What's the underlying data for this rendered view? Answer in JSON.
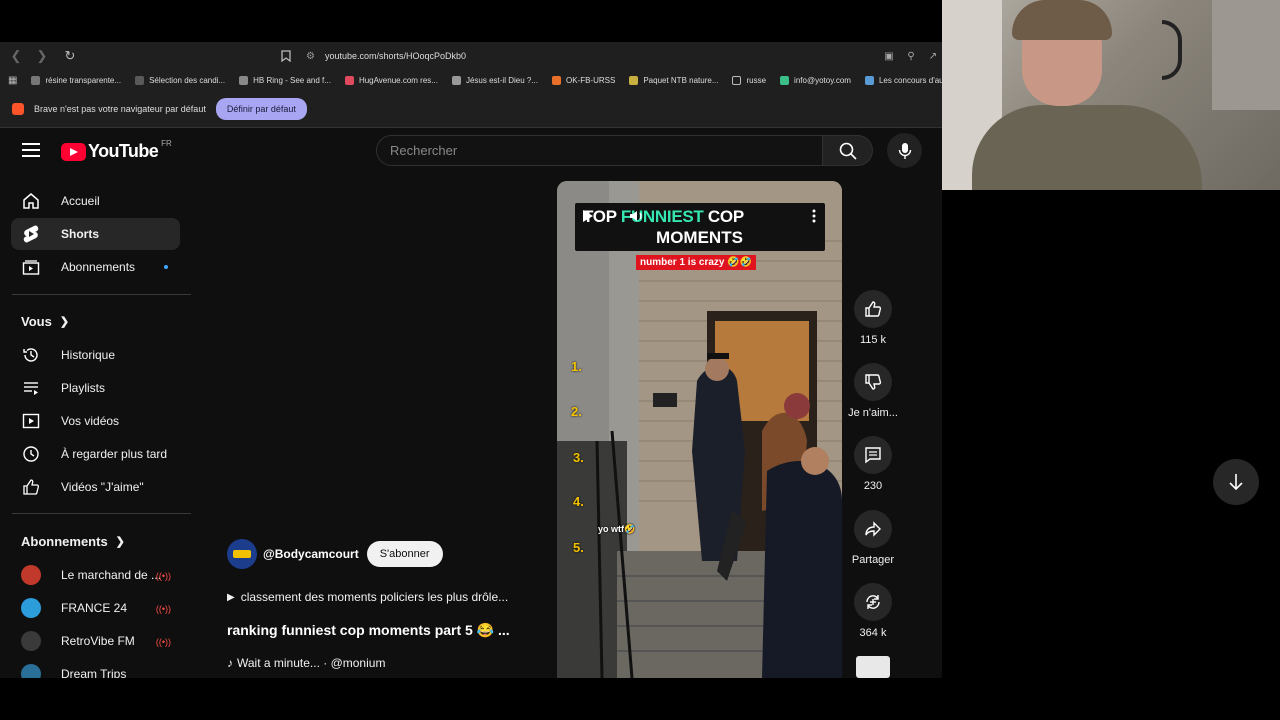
{
  "browser": {
    "url": "youtube.com/shorts/HOoqcPoDkb0",
    "bookmarks": [
      {
        "label": "résine transparente...",
        "color": "#777777"
      },
      {
        "label": "Sélection des candi...",
        "color": "#5a5a5a"
      },
      {
        "label": "HB Ring - See and f...",
        "color": "#888888"
      },
      {
        "label": "HugAvenue.com res...",
        "color": "#e04a5f"
      },
      {
        "label": "Jésus est-il Dieu ?...",
        "color": "#999999"
      },
      {
        "label": "OK-FB-URSS",
        "color": "#e8702a"
      },
      {
        "label": "Paquet NTB nature...",
        "color": "#c8b040"
      },
      {
        "label": "russe",
        "color": "#bbbbbb"
      },
      {
        "label": "info@yotoy.com",
        "color": "#3bbf88"
      },
      {
        "label": "Les concours d'aute...",
        "color": "#5b9bd5"
      }
    ],
    "infobar_text": "Brave n'est pas votre navigateur par défaut",
    "default_button": "Définir par défaut"
  },
  "youtube": {
    "logo_text": "YouTube",
    "region": "FR",
    "search_placeholder": "Rechercher",
    "sidebar": {
      "main": [
        {
          "label": "Accueil",
          "icon": "home-icon"
        },
        {
          "label": "Shorts",
          "icon": "shorts-icon",
          "active": true
        },
        {
          "label": "Abonnements",
          "icon": "subscriptions-icon"
        }
      ],
      "you_heading": "Vous",
      "you_items": [
        {
          "label": "Historique",
          "icon": "history-icon"
        },
        {
          "label": "Playlists",
          "icon": "playlists-icon"
        },
        {
          "label": "Vos vidéos",
          "icon": "your-videos-icon"
        },
        {
          "label": "À regarder plus tard",
          "icon": "watch-later-icon"
        },
        {
          "label": "Vidéos \"J'aime\"",
          "icon": "liked-videos-icon"
        }
      ],
      "subs_heading": "Abonnements",
      "channels": [
        {
          "label": "Le marchand de ...",
          "color": "#c0392b"
        },
        {
          "label": "FRANCE 24",
          "color": "#2d9cdb"
        },
        {
          "label": "RetroVibe FM",
          "color": "#3a3a3a"
        },
        {
          "label": "Dream Trips",
          "color": "#2a6f97"
        }
      ]
    },
    "video": {
      "overlay_line1_a": "TOP",
      "overlay_line1_b": "FUNNIEST",
      "overlay_line1_c": "COP",
      "overlay_line2": "MOMENTS",
      "overlay_red": "number 1 is crazy 🤣🤣",
      "ranks": [
        "1.",
        "2.",
        "3.",
        "4.",
        "5."
      ],
      "caption": "yo wtf🤣"
    },
    "actions": {
      "likes": "115 k",
      "dislike_label": "Je n'aim...",
      "comments": "230",
      "share_label": "Partager",
      "remix": "364 k"
    },
    "info": {
      "channel": "@Bodycamcourt",
      "subscribe": "S'abonner",
      "description": "classement des moments policiers les plus drôle...",
      "title": "ranking funniest cop moments part 5 😂 ...",
      "music": "Wait a minute... · @monium"
    }
  }
}
